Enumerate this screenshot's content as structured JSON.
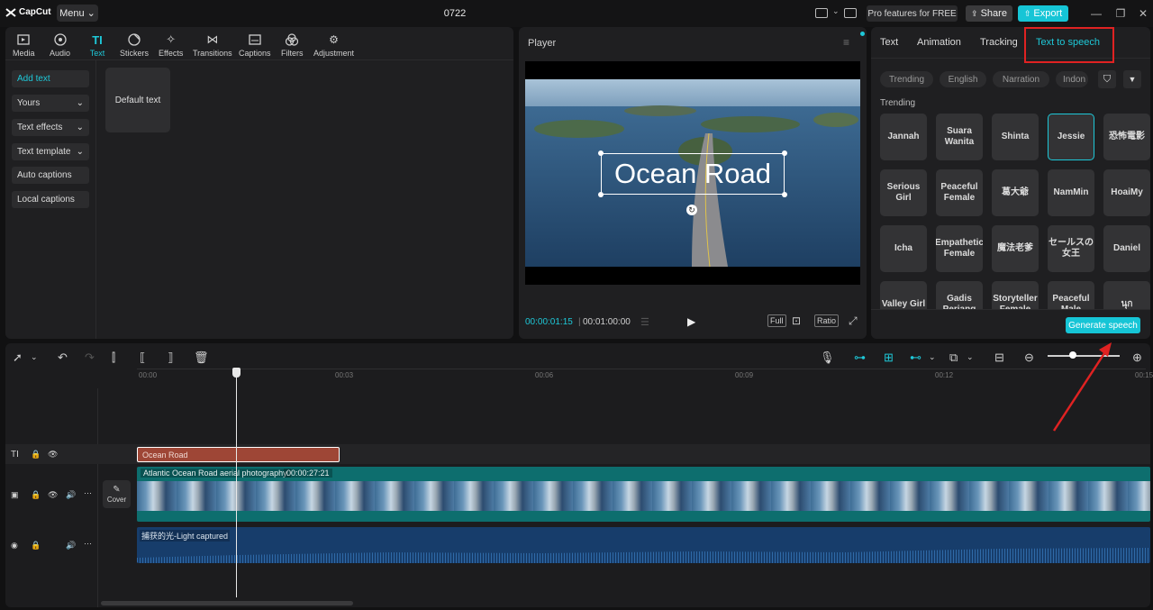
{
  "titlebar": {
    "logo": "CapCut",
    "menu_label": "Menu",
    "project_name": "0722",
    "pro_label": "Pro features for FREE",
    "share_label": "Share",
    "export_label": "Export"
  },
  "toolbar": {
    "tools": [
      {
        "label": "Media",
        "icon": "media-icon"
      },
      {
        "label": "Audio",
        "icon": "audio-icon"
      },
      {
        "label": "Text",
        "icon": "text-icon"
      },
      {
        "label": "Stickers",
        "icon": "stickers-icon"
      },
      {
        "label": "Effects",
        "icon": "effects-icon"
      },
      {
        "label": "Transitions",
        "icon": "transitions-icon"
      },
      {
        "label": "Captions",
        "icon": "captions-icon"
      },
      {
        "label": "Filters",
        "icon": "filters-icon"
      },
      {
        "label": "Adjustment",
        "icon": "adjustment-icon"
      }
    ],
    "active": "Text"
  },
  "text_nav": {
    "items": [
      "Add text",
      "Yours",
      "Text effects",
      "Text template",
      "Auto captions",
      "Local captions"
    ],
    "default_text_label": "Default text"
  },
  "player": {
    "title": "Player",
    "overlay_text": "Ocean Road",
    "current_time": "00:00:01:15",
    "total_time": "00:01:00:00",
    "full_label": "Full",
    "ratio_label": "Ratio"
  },
  "right_panel": {
    "tabs": [
      "Text",
      "Animation",
      "Tracking",
      "Text to speech"
    ],
    "active_tab": "Text to speech",
    "filters": [
      "Trending",
      "English",
      "Narration",
      "Indon"
    ],
    "section_label": "Trending",
    "voices": [
      "Jannah",
      "Suara Wanita",
      "Shinta",
      "Jessie",
      "恐怖電影",
      "Serious Girl",
      "Peaceful Female",
      "葛大爺",
      "NamMin",
      "HoaiMy",
      "Icha",
      "Empathetic Female",
      "魔法老爹",
      "セールスの女王",
      "Daniel",
      "Valley Girl",
      "Gadis Periang",
      "Storyteller Female",
      "Peaceful Male",
      "นุก"
    ],
    "selected_voice": "Jessie",
    "generate_label": "Generate speech"
  },
  "timeline": {
    "ticks": [
      "00:00",
      "00:03",
      "00:06",
      "00:09",
      "00:12",
      "00:15"
    ],
    "text_clip": "Ocean Road",
    "video_clip_name": "Atlantic Ocean Road aerial photography.",
    "video_clip_duration": "00:00:27:21",
    "cover_label": "Cover",
    "audio_clip_name": "捕获的光-Light captured"
  },
  "colors": {
    "accent": "#1ec8d8",
    "highlight": "#e02222",
    "text_clip": "#9e4636",
    "video_clip": "#0d6e6e",
    "audio_clip": "#173d6b"
  }
}
